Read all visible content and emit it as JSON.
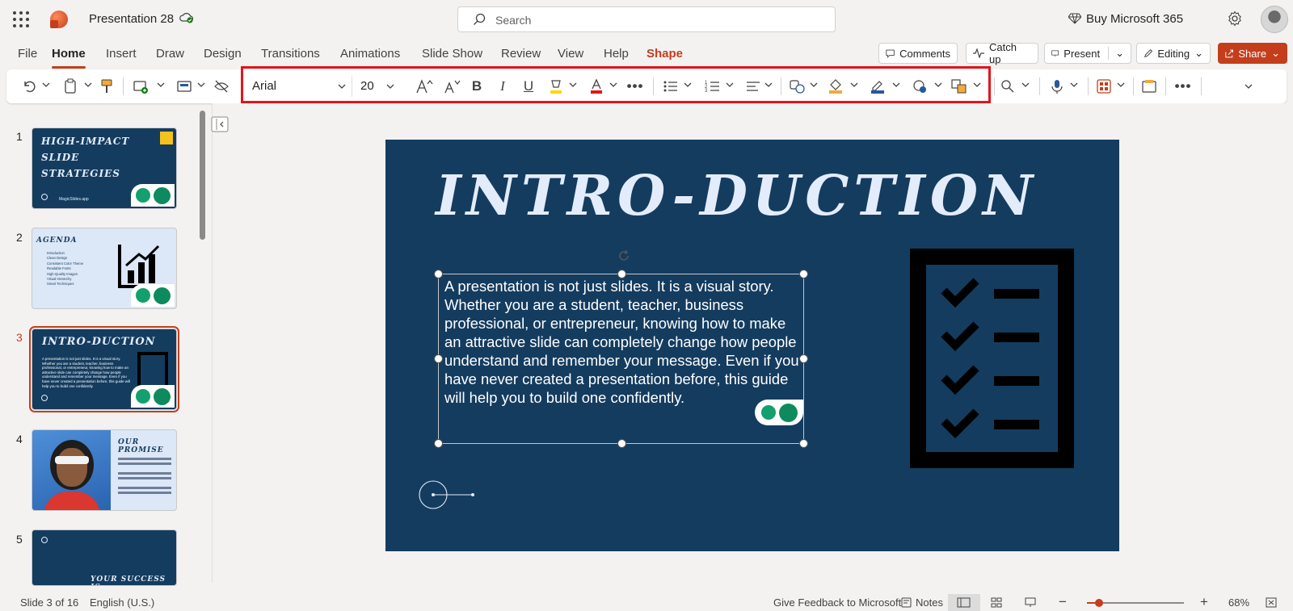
{
  "titlebar": {
    "doc_title": "Presentation 28",
    "search_placeholder": "Search",
    "buy_label": "Buy Microsoft 365"
  },
  "menu": {
    "tabs": [
      "File",
      "Home",
      "Insert",
      "Draw",
      "Design",
      "Transitions",
      "Animations",
      "Slide Show",
      "Review",
      "View",
      "Help",
      "Shape"
    ],
    "active_tab": "Home",
    "comments": "Comments",
    "catch_up": "Catch up",
    "present": "Present",
    "editing": "Editing",
    "share": "Share"
  },
  "ribbon": {
    "font_name": "Arial",
    "font_size": "20",
    "icons": [
      "undo-icon",
      "clipboard-icon",
      "format-painter-icon",
      "new-slide-icon",
      "layout-icon",
      "hide-slide-icon",
      "increase-font-icon",
      "decrease-font-icon",
      "bold-icon",
      "italic-icon",
      "underline-icon",
      "highlight-icon",
      "font-color-icon",
      "more-icon",
      "bullets-icon",
      "numbering-icon",
      "align-icon",
      "shapes-icon",
      "shape-fill-icon",
      "shape-outline-icon",
      "shape-effects-icon",
      "arrange-icon",
      "find-icon",
      "dictate-icon",
      "designer-icon",
      "add-in-icon",
      "more-options-icon"
    ],
    "highlight_color": "#e2151a"
  },
  "slides": [
    {
      "num": "1",
      "title": "HIGH-IMPACT SLIDE STRATEGIES",
      "footer": "MagicSlides.app"
    },
    {
      "num": "2",
      "title": "AGENDA",
      "items": [
        "Introduction",
        "Clean Design",
        "Consistent Color Theme",
        "Readable Fonts",
        "High-Quality Images",
        "Visual Hierarchy",
        "Smart Techniques"
      ]
    },
    {
      "num": "3",
      "title": "INTRO-DUCTION"
    },
    {
      "num": "4",
      "title": "OUR PROMISE"
    },
    {
      "num": "5",
      "title": "YOUR SUCCESS IS"
    }
  ],
  "active_slide": "3",
  "main_slide": {
    "title": "INTRO-DUCTION",
    "body": "A presentation is not just slides. It is a visual story. Whether you are a student, teacher, business professional, or entrepreneur, knowing how to make an attractive slide can completely change how people understand and remember your message. Even if you have never created a presentation before, this guide will help you to build one confidently.",
    "background": "#143c5f"
  },
  "status": {
    "slide_count": "Slide 3 of 16",
    "language": "English (U.S.)",
    "feedback": "Give Feedback to Microsoft",
    "notes": "Notes",
    "zoom": "68%"
  }
}
